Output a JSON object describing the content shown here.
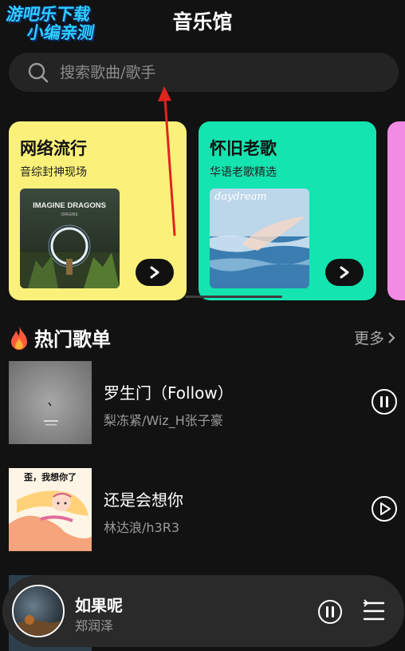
{
  "watermark": {
    "line1": "游吧乐下载",
    "line2": "小编亲测"
  },
  "header": {
    "title": "音乐馆"
  },
  "search": {
    "placeholder": "搜索歌曲/歌手"
  },
  "cards": [
    {
      "title": "网络流行",
      "subtitle": "音综封神现场",
      "color": "#fbf17a",
      "cover_text": "IMAGINE DRAGONS",
      "cover_sub": "ORIGINS"
    },
    {
      "title": "怀旧老歌",
      "subtitle": "华语老歌精选",
      "color": "#14e4b0",
      "cover_text": "daydream"
    },
    {
      "color": "#f28be3"
    }
  ],
  "section": {
    "title": "热门歌单",
    "more_label": "更多"
  },
  "songs": [
    {
      "title": "罗生门（Follow）",
      "artist": "梨冻紧/Wiz_H张子豪",
      "state_icon": "pause-circle-icon"
    },
    {
      "title": "还是会想你",
      "artist": "林达浪/h3R3",
      "cover_caption": "歪，我想你了",
      "state_icon": "play-circle-icon"
    }
  ],
  "mini_player": {
    "title": "如果呢",
    "artist": "郑润泽"
  },
  "colors": {
    "background": "#121212",
    "search_bg": "#242424",
    "secondary_text": "#9a9a9a"
  }
}
